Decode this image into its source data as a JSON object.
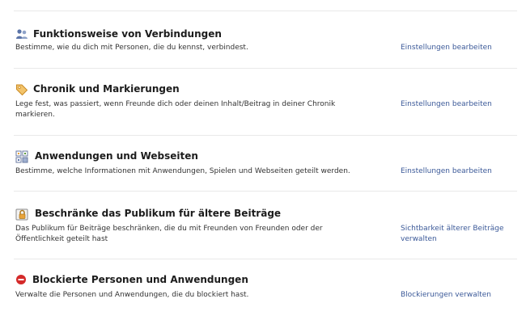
{
  "sections": [
    {
      "icon": "people-icon",
      "title": "Funktionsweise von Verbindungen",
      "description": "Bestimme, wie du dich mit Personen, die du kennst, verbindest.",
      "action": "Einstellungen bearbeiten"
    },
    {
      "icon": "tag-icon",
      "title": "Chronik und Markierungen",
      "description": "Lege fest, was passiert, wenn Freunde dich oder deinen Inhalt/Beitrag in deiner Chronik markieren.",
      "action": "Einstellungen bearbeiten"
    },
    {
      "icon": "apps-icon",
      "title": "Anwendungen und Webseiten",
      "description": "Bestimme, welche Informationen mit Anwendungen, Spielen und Webseiten geteilt werden.",
      "action": "Einstellungen bearbeiten"
    },
    {
      "icon": "lock-icon",
      "title": "Beschränke das Publikum für ältere Beiträge",
      "description": "Das Publikum für Beiträge beschränken, die du mit Freunden von Freunden oder der Öffentlichkeit geteilt hast",
      "action": "Sichtbarkeit älterer Beiträge verwalten"
    },
    {
      "icon": "block-icon",
      "title": "Blockierte Personen und Anwendungen",
      "description": "Verwalte die Personen und Anwendungen, die du blockiert hast.",
      "action": "Blockierungen verwalten"
    }
  ],
  "colors": {
    "link": "#3b5998",
    "title": "#1c1c1c",
    "divider": "#e9e9e9",
    "block_red": "#d42a2a",
    "tag_orange": "#e8a33a"
  }
}
